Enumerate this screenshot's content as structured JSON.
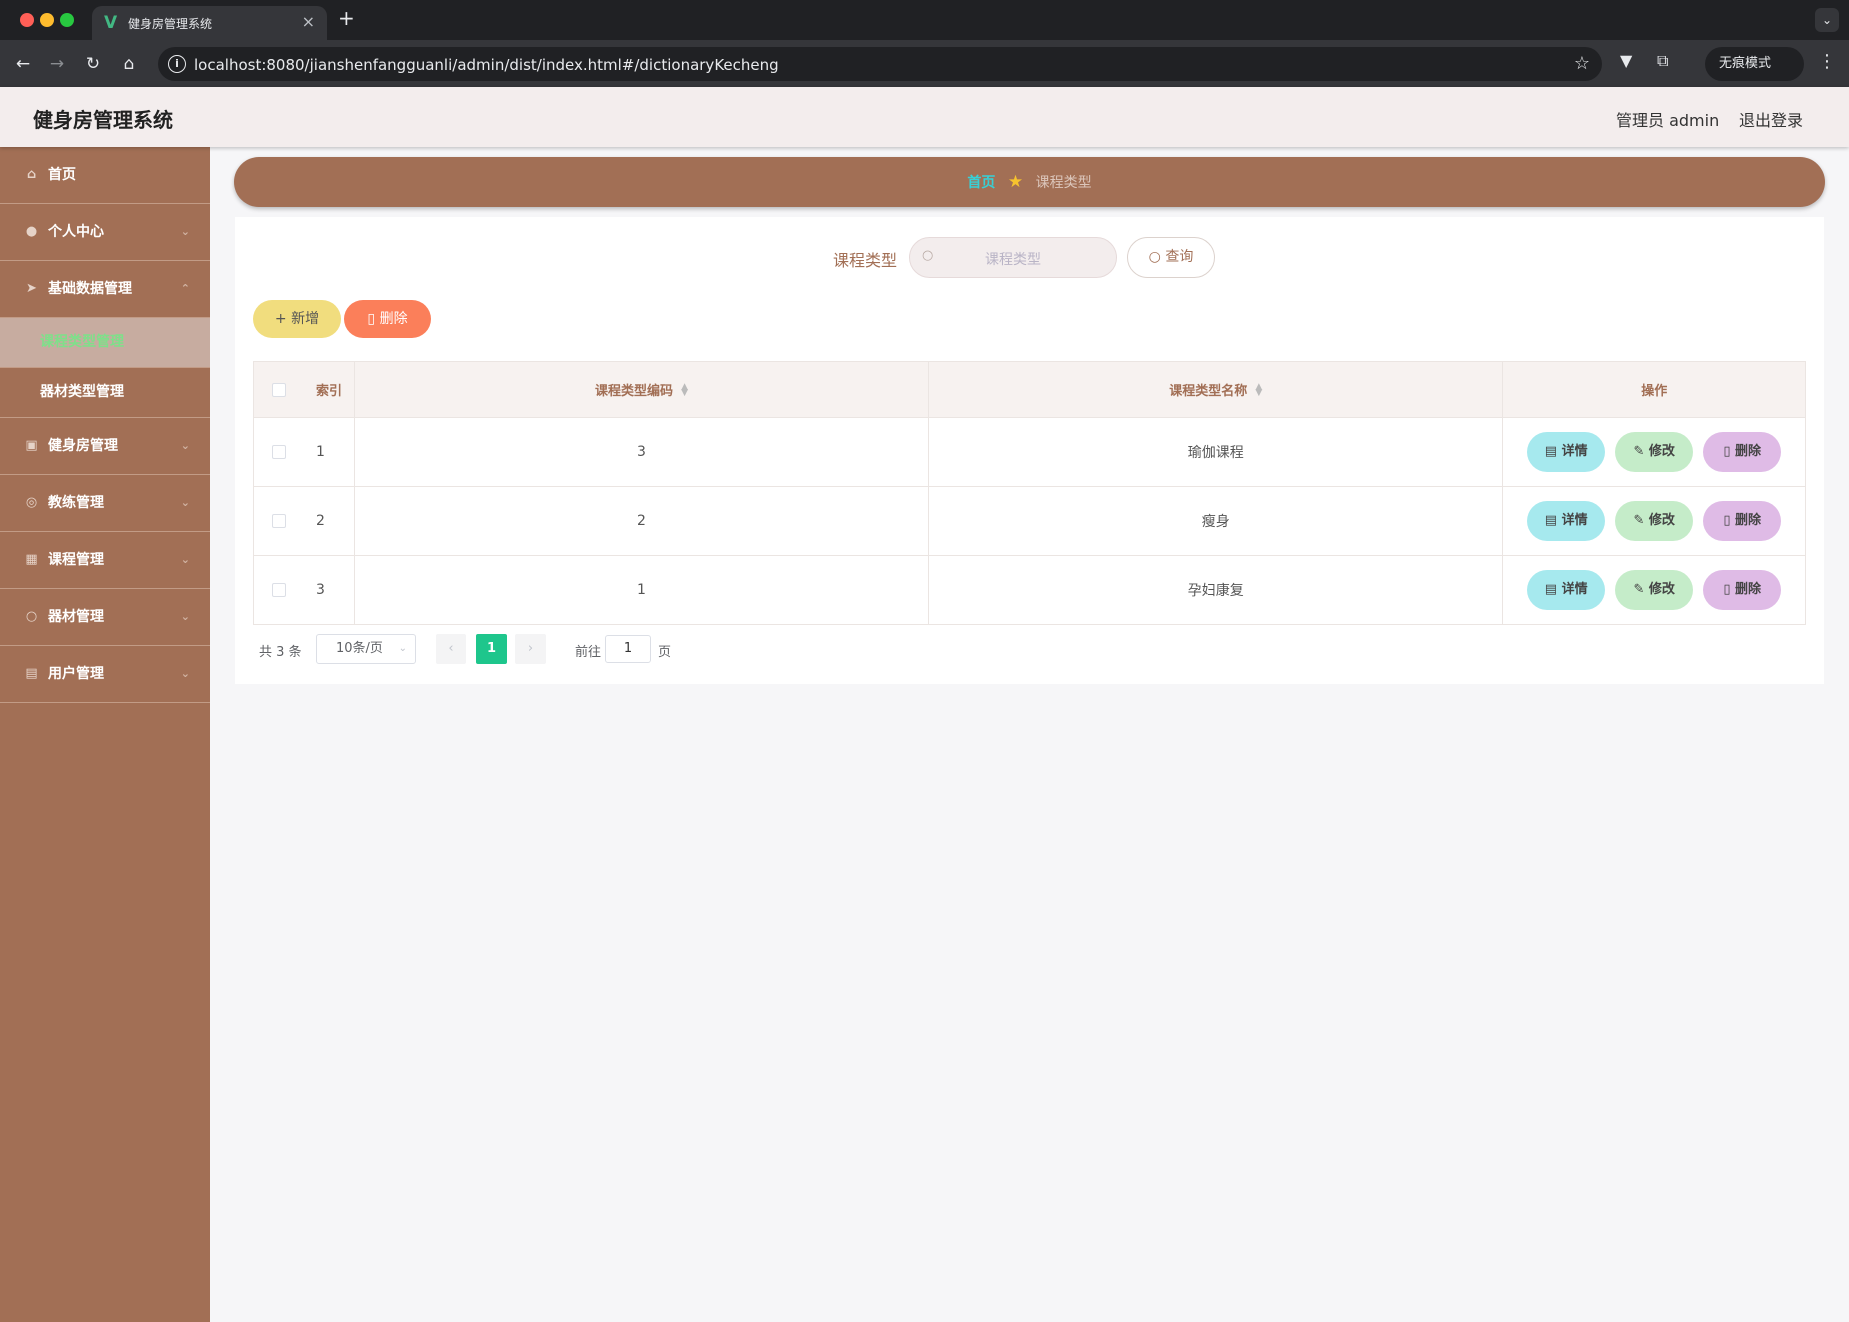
{
  "browser": {
    "tab_title": "健身房管理系统",
    "tab_close": "×",
    "new_tab": "+",
    "url": "localhost:8080/jianshenfangguanli/admin/dist/index.html#/dictionaryKecheng",
    "incognito_label": "无痕模式",
    "tab_menu": "⌄",
    "info_glyph": "i",
    "star_glyph": "☆",
    "menu_glyph": "⋮"
  },
  "header": {
    "app_title": "健身房管理系统",
    "user_label": "管理员 admin",
    "logout_label": "退出登录"
  },
  "sidebar": {
    "items": [
      {
        "label": "首页",
        "icon": "home-icon"
      },
      {
        "label": "个人中心",
        "icon": "user-icon"
      },
      {
        "label": "基础数据管理",
        "icon": "send-icon"
      },
      {
        "label": "健身房管理",
        "icon": "box-icon"
      },
      {
        "label": "教练管理",
        "icon": "compass-icon"
      },
      {
        "label": "课程管理",
        "icon": "grid-icon"
      },
      {
        "label": "器材管理",
        "icon": "power-icon"
      },
      {
        "label": "用户管理",
        "icon": "clipboard-icon"
      }
    ],
    "sub_items": [
      {
        "label": "课程类型管理",
        "active": true
      },
      {
        "label": "器材类型管理",
        "active": false
      }
    ]
  },
  "breadcrumb": {
    "home": "首页",
    "separator": "★",
    "current": "课程类型"
  },
  "search": {
    "label": "课程类型",
    "placeholder": "课程类型",
    "button": "查询"
  },
  "actions": {
    "add": "新增",
    "delete": "删除"
  },
  "table": {
    "columns": {
      "index": "索引",
      "code": "课程类型编码",
      "name": "课程类型名称",
      "ops": "操作"
    },
    "rows": [
      {
        "index": "1",
        "code": "3",
        "name": "瑜伽课程"
      },
      {
        "index": "2",
        "code": "2",
        "name": "瘦身"
      },
      {
        "index": "3",
        "code": "1",
        "name": "孕妇康复"
      }
    ],
    "row_actions": {
      "detail": "详情",
      "edit": "修改",
      "delete": "删除"
    }
  },
  "pagination": {
    "total": "共 3 条",
    "page_size": "10条/页",
    "current_page": "1",
    "goto_label": "前往",
    "goto_value": "1",
    "page_unit": "页"
  },
  "colors": {
    "sidebar": "#a26f55",
    "header": "#f3eded",
    "active_sub": "#7ee08a",
    "breadcrumb_home": "#37d0d7",
    "add_button": "#f1dd7e",
    "delete_button": "#fb7f5a",
    "detail_button": "#a6e9ee",
    "edit_button": "#c5ecc9",
    "row_delete_button": "#dfbbe6",
    "pagination_active": "#1ec68c"
  }
}
